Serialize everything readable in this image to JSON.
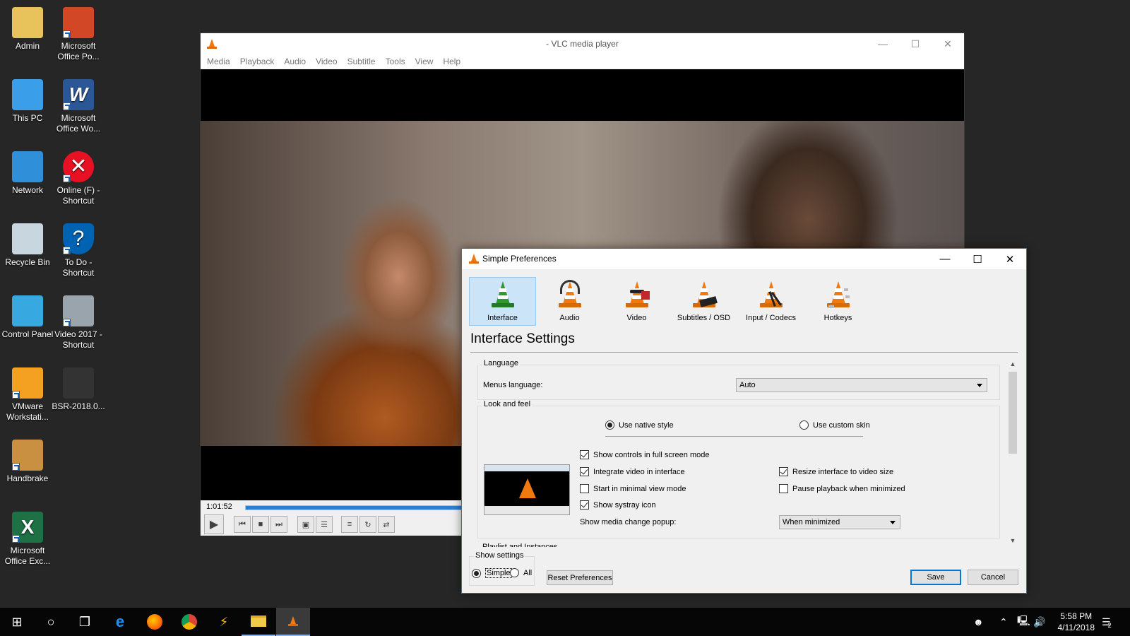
{
  "desktop": {
    "icons": [
      {
        "label": "Admin",
        "icon": "user-folder-icon",
        "shortcut": false
      },
      {
        "label": "Microsoft Office Po...",
        "icon": "powerpoint-icon",
        "shortcut": true
      },
      {
        "label": "This PC",
        "icon": "computer-icon",
        "shortcut": false
      },
      {
        "label": "Microsoft Office Wo...",
        "icon": "word-icon",
        "shortcut": true
      },
      {
        "label": "Network",
        "icon": "network-icon",
        "shortcut": false
      },
      {
        "label": "Online (F) - Shortcut",
        "icon": "error-drive-icon",
        "shortcut": true
      },
      {
        "label": "Recycle Bin",
        "icon": "recycle-bin-icon",
        "shortcut": false
      },
      {
        "label": "To Do - Shortcut",
        "icon": "help-shield-icon",
        "shortcut": true
      },
      {
        "label": "Control Panel",
        "icon": "control-panel-icon",
        "shortcut": false
      },
      {
        "label": "Video 2017 - Shortcut",
        "icon": "camcorder-icon",
        "shortcut": true
      },
      {
        "label": "VMware Workstati...",
        "icon": "vmware-icon",
        "shortcut": true
      },
      {
        "label": "BSR-2018.0...",
        "icon": "video-file-icon",
        "shortcut": false
      },
      {
        "label": "Handbrake",
        "icon": "handbrake-icon",
        "shortcut": true
      },
      {
        "label": "Microsoft Office Exc...",
        "icon": "excel-icon",
        "shortcut": true
      }
    ]
  },
  "vlc": {
    "title": " - VLC media player",
    "menu": [
      {
        "key": "M",
        "rest": "edia"
      },
      {
        "key": "P",
        "rest": "layback",
        "pre": "",
        "full": "Playback"
      },
      {
        "key": "A",
        "rest": "udio"
      },
      {
        "key": "V",
        "rest": "ideo"
      },
      {
        "key": "",
        "full": "Subtitle"
      },
      {
        "key": "",
        "full": "Tools"
      },
      {
        "key": "",
        "full": "View"
      },
      {
        "key": "H",
        "rest": "elp"
      }
    ],
    "menu_labels": [
      "Media",
      "Playback",
      "Audio",
      "Video",
      "Subtitle",
      "Tools",
      "View",
      "Help"
    ],
    "elapsed": "1:01:52",
    "progress": 0.33
  },
  "prefs": {
    "title": "Simple Preferences",
    "categories": [
      {
        "label": "Interface",
        "selected": true
      },
      {
        "label": "Audio",
        "selected": false
      },
      {
        "label": "Video",
        "selected": false
      },
      {
        "label": "Subtitles / OSD",
        "selected": false
      },
      {
        "label": "Input / Codecs",
        "selected": false
      },
      {
        "label": "Hotkeys",
        "selected": false
      }
    ],
    "section_title": "Interface Settings",
    "language_group": "Language",
    "menus_language_label": "Menus language:",
    "menus_language_value": "Auto",
    "look_group": "Look and feel",
    "native_style": "Use native style",
    "custom_skin": "Use custom skin",
    "checks": {
      "fullscreen_controls": {
        "label": "Show controls in full screen mode",
        "checked": true
      },
      "integrate_video": {
        "label": "Integrate video in interface",
        "checked": true
      },
      "minimal_view": {
        "label": "Start in minimal view mode",
        "checked": false
      },
      "systray": {
        "label": "Show systray icon",
        "checked": true
      },
      "resize_interface": {
        "label": "Resize interface to video size",
        "checked": true
      },
      "pause_minimized": {
        "label": "Pause playback when minimized",
        "checked": false
      }
    },
    "media_popup_label": "Show media change popup:",
    "media_popup_value": "When minimized",
    "next_group_partial": "Playlist and Instances",
    "show_settings_label": "Show settings",
    "simple_label": "Simple",
    "all_label": "All",
    "reset_label": "Reset Preferences",
    "save_label": "Save",
    "cancel_label": "Cancel"
  },
  "taskbar": {
    "apps": [
      "start",
      "search",
      "task-view",
      "edge",
      "firefox",
      "chrome",
      "winamp",
      "file-explorer",
      "vlc"
    ],
    "time": "5:58 PM",
    "date": "4/11/2018",
    "notification_count": "2"
  }
}
